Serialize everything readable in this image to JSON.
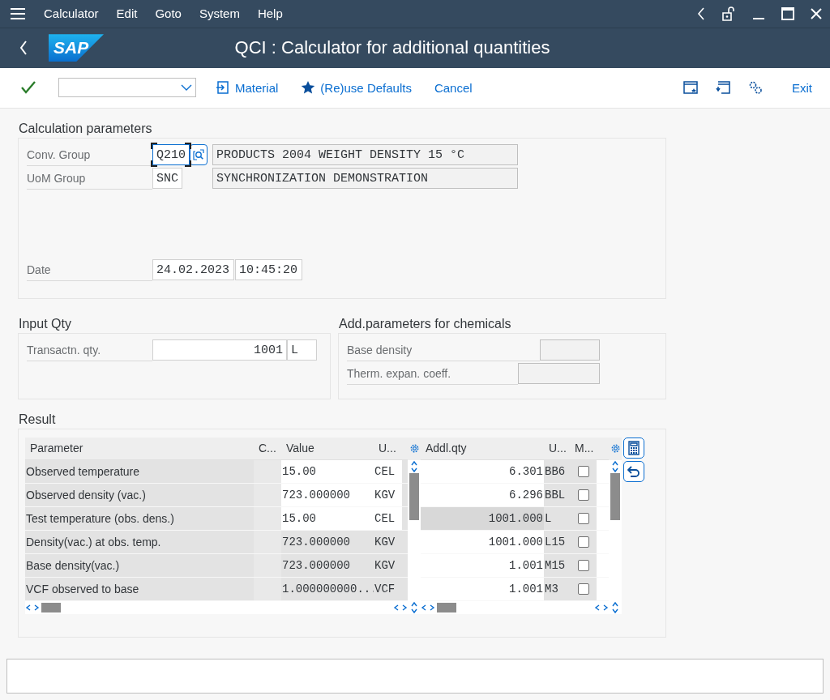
{
  "menu_bar": {
    "items": [
      "Calculator",
      "Edit",
      "Goto",
      "System",
      "Help"
    ]
  },
  "header": {
    "logo_text": "SAP",
    "title": "QCI : Calculator for additional quantities"
  },
  "toolbar": {
    "buttons": [
      {
        "label": "Material",
        "kind": "material"
      },
      {
        "label": "(Re)use Defaults",
        "kind": "star"
      },
      {
        "label": "Cancel",
        "kind": "plain"
      }
    ],
    "exit_label": "Exit"
  },
  "calculation_parameters": {
    "title": "Calculation parameters",
    "fields": [
      {
        "label": "Conv. Group",
        "value": "Q210",
        "description": "PRODUCTS 2004 WEIGHT DENSITY 15 °C",
        "focused": true
      },
      {
        "label": "UoM Group",
        "value": "SNC",
        "description": "SYNCHRONIZATION DEMONSTRATION",
        "focused": false
      }
    ],
    "date": {
      "label": "Date",
      "date": "24.02.2023",
      "time": "10:45:20"
    }
  },
  "input_qty": {
    "title": "Input Qty",
    "label": "Transactn. qty.",
    "value": "1001",
    "unit": "L"
  },
  "chemicals": {
    "title": "Add.parameters for chemicals",
    "fields": [
      {
        "label": "Base density"
      },
      {
        "label": "Therm. expan. coeff."
      }
    ]
  },
  "result": {
    "title": "Result",
    "parameters_table": {
      "columns": [
        "Parameter",
        "C...",
        "Value",
        "U..."
      ],
      "rows": [
        {
          "parameter": "Observed temperature",
          "value": "15.00",
          "unit": "CEL",
          "editable": true
        },
        {
          "parameter": "Observed density (vac.)",
          "value": "723.000000",
          "unit": "KGV",
          "editable": true
        },
        {
          "parameter": "Test temperature (obs. dens.)",
          "value": "15.00",
          "unit": "CEL",
          "editable": true
        },
        {
          "parameter": "Density(vac.) at obs. temp.",
          "value": "723.000000",
          "unit": "KGV",
          "editable": false
        },
        {
          "parameter": "Base density(vac.)",
          "value": "723.000000",
          "unit": "KGV",
          "editable": false
        },
        {
          "parameter": "VCF observed to base",
          "value": "1.000000000...",
          "unit": "VCF",
          "editable": false
        }
      ]
    },
    "quantities_table": {
      "columns": [
        "Addl.qty",
        "U...",
        "M..."
      ],
      "rows": [
        {
          "quantity": "6.301",
          "unit": "BB6",
          "checked": false,
          "selected": false
        },
        {
          "quantity": "6.296",
          "unit": "BBL",
          "checked": false,
          "selected": false
        },
        {
          "quantity": "1001.000",
          "unit": "L",
          "checked": false,
          "selected": true
        },
        {
          "quantity": "1001.000",
          "unit": "L15",
          "checked": false,
          "selected": false
        },
        {
          "quantity": "1.001",
          "unit": "M15",
          "checked": false,
          "selected": false
        },
        {
          "quantity": "1.001",
          "unit": "M3",
          "checked": false,
          "selected": false
        }
      ]
    }
  }
}
